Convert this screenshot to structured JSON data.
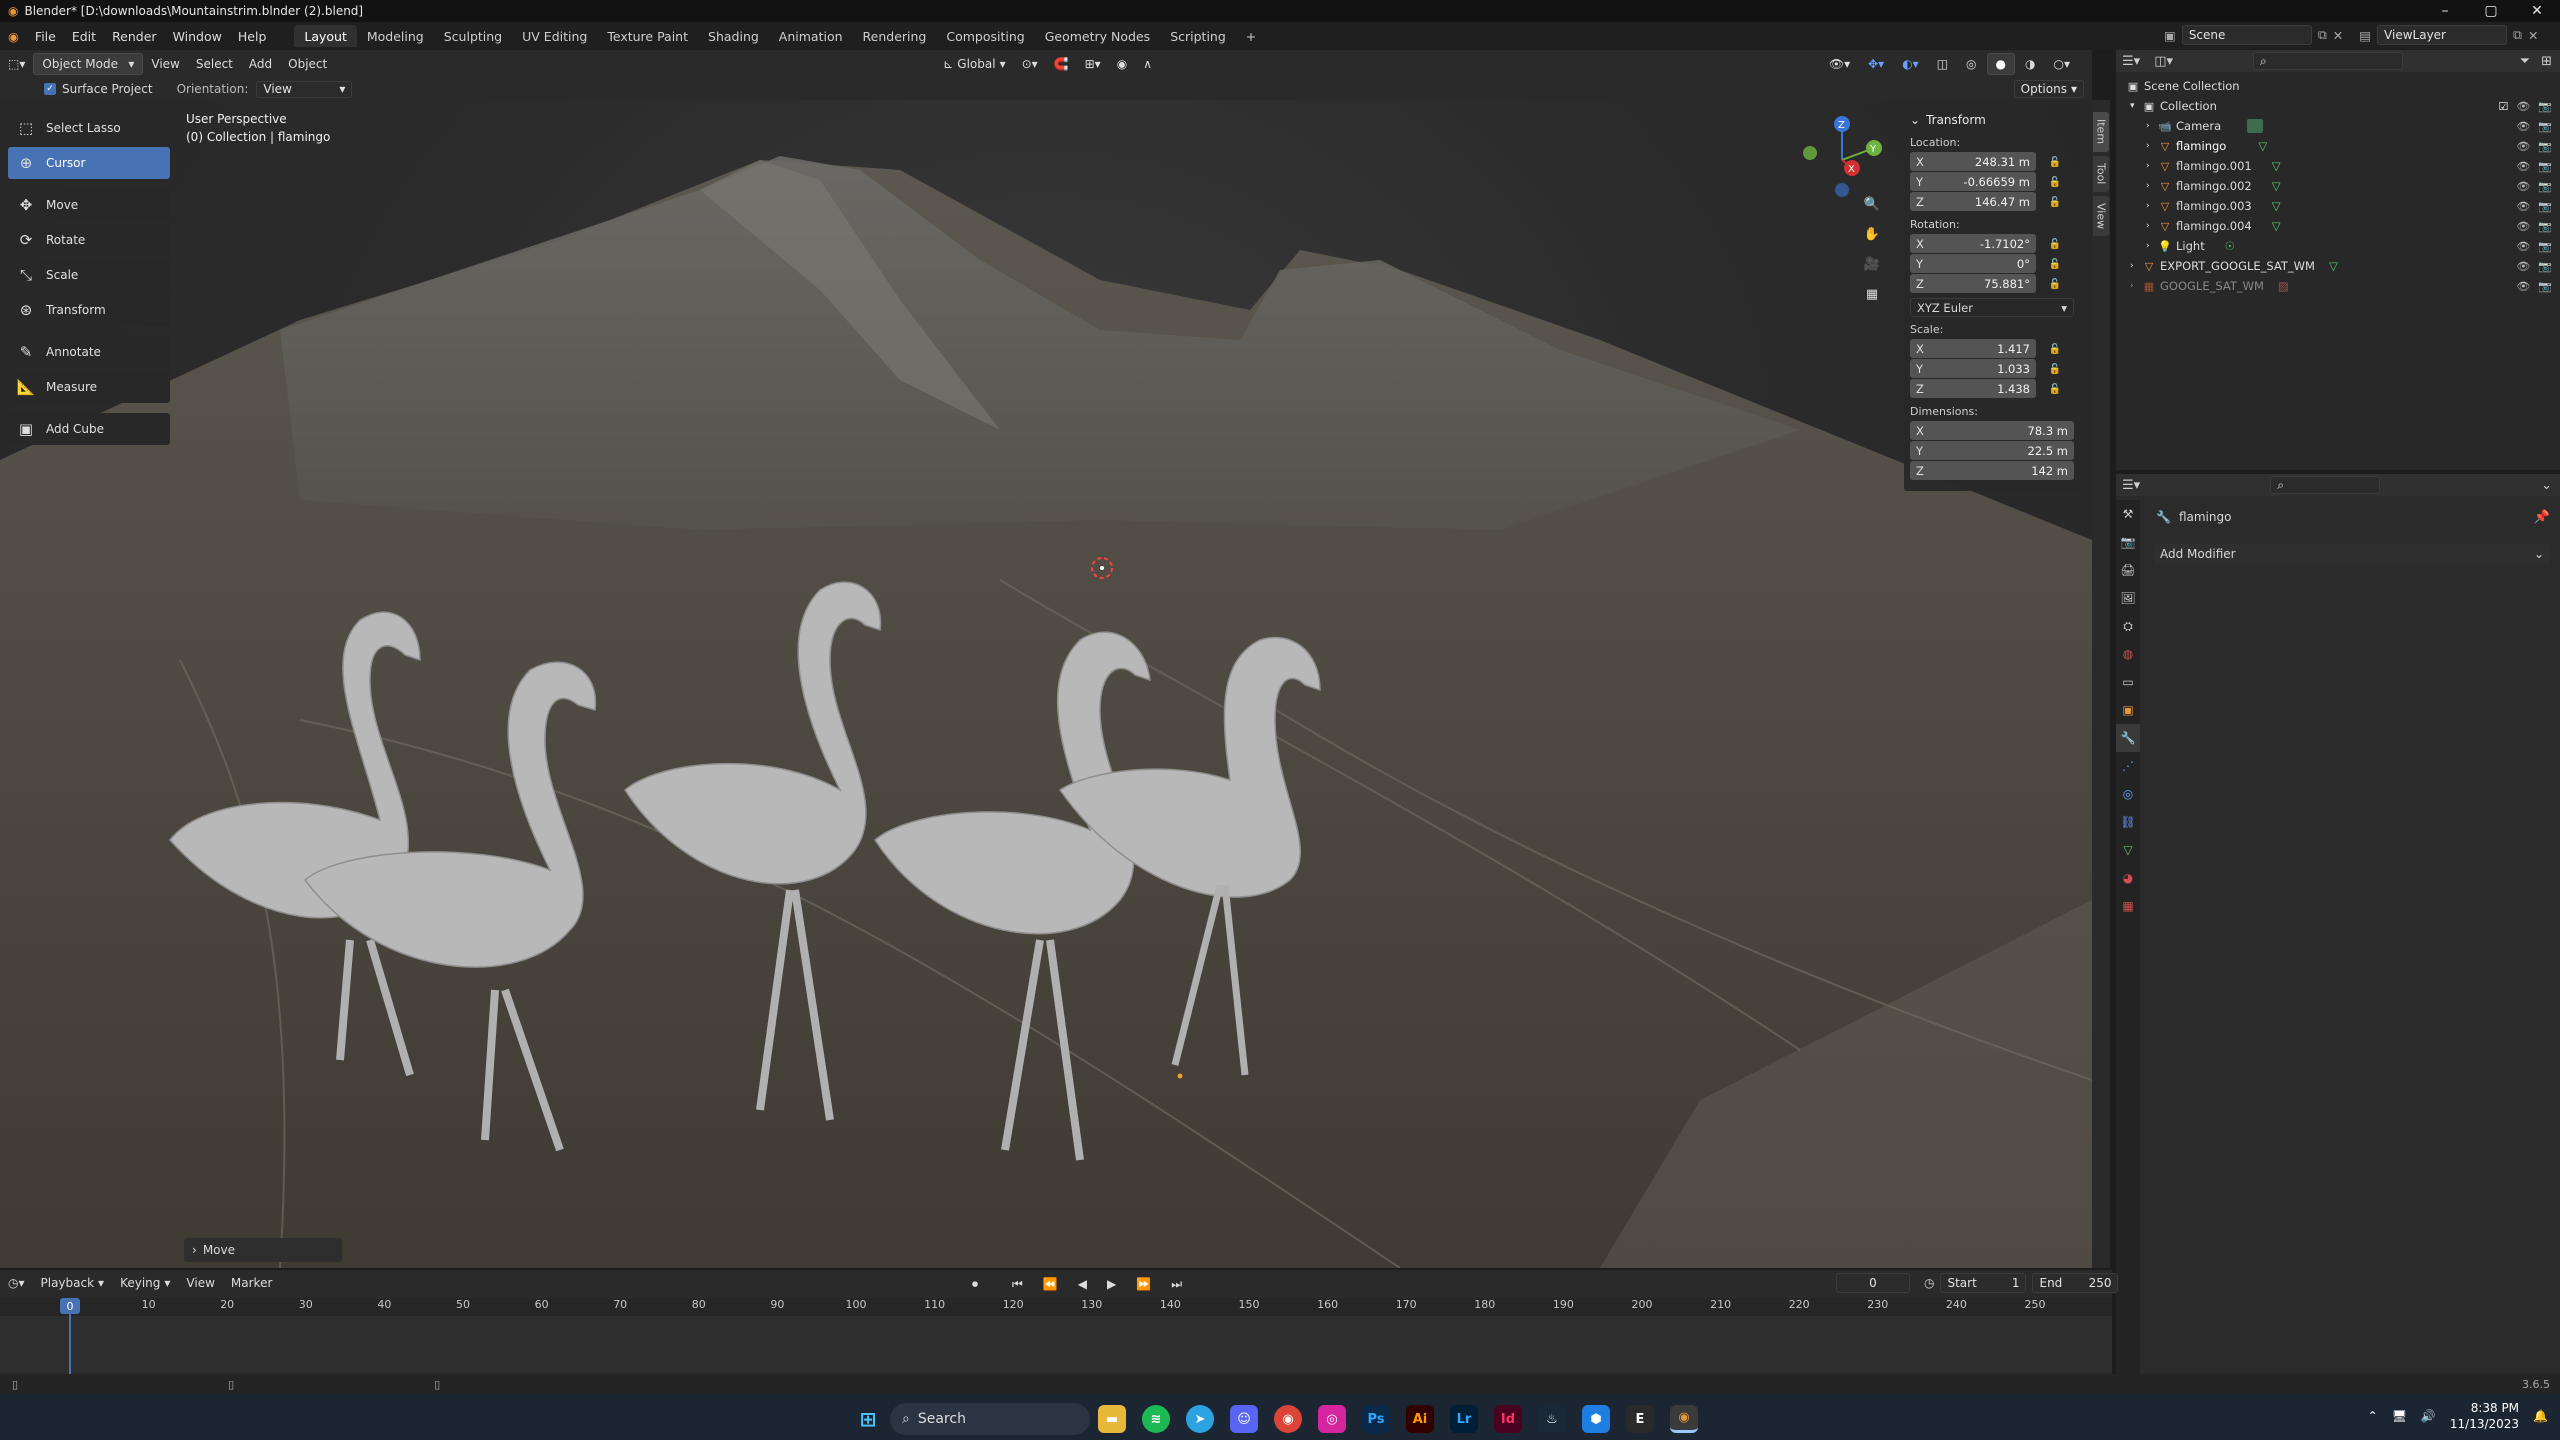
{
  "window": {
    "title": "Blender* [D:\\downloads\\Mountainstrim.blnder (2).blend]",
    "controls": [
      "–",
      "▢",
      "✕"
    ]
  },
  "menus": [
    "File",
    "Edit",
    "Render",
    "Window",
    "Help"
  ],
  "workspaces": [
    "Layout",
    "Modeling",
    "Sculpting",
    "UV Editing",
    "Texture Paint",
    "Shading",
    "Animation",
    "Rendering",
    "Compositing",
    "Geometry Nodes",
    "Scripting"
  ],
  "workspace_add": "+",
  "scene": {
    "label": "Scene",
    "viewlayer": "ViewLayer"
  },
  "viewport_header": {
    "mode": "Object Mode",
    "menus": [
      "View",
      "Select",
      "Add",
      "Object"
    ],
    "orientation": "Global"
  },
  "tool_options": {
    "surface_project": "Surface Project",
    "orientation_label": "Orientation:",
    "orientation_value": "View",
    "options": "Options"
  },
  "viewport": {
    "perspective": "User Perspective",
    "collection_info": "(0) Collection | flamingo",
    "gizmo": {
      "z": "Z",
      "y": "Y",
      "x": "X"
    },
    "last_op": "Move"
  },
  "toolbar": [
    {
      "label": "Select Lasso",
      "icon": "lasso-icon",
      "active": false
    },
    {
      "label": "Cursor",
      "icon": "cursor-icon",
      "active": true
    },
    {
      "label": "Move",
      "icon": "move-icon",
      "active": false
    },
    {
      "label": "Rotate",
      "icon": "rotate-icon",
      "active": false
    },
    {
      "label": "Scale",
      "icon": "scale-icon",
      "active": false
    },
    {
      "label": "Transform",
      "icon": "transform-icon",
      "active": false
    },
    {
      "label": "Annotate",
      "icon": "annotate-icon",
      "active": false
    },
    {
      "label": "Measure",
      "icon": "measure-icon",
      "active": false
    },
    {
      "label": "Add Cube",
      "icon": "add-cube-icon",
      "active": false
    }
  ],
  "npanel": {
    "title": "Transform",
    "location_label": "Location:",
    "location": [
      [
        "X",
        "248.31 m"
      ],
      [
        "Y",
        "-0.66659 m"
      ],
      [
        "Z",
        "146.47 m"
      ]
    ],
    "rotation_label": "Rotation:",
    "rotation": [
      [
        "X",
        "-1.7102°"
      ],
      [
        "Y",
        "0°"
      ],
      [
        "Z",
        "75.881°"
      ]
    ],
    "rotation_mode": "XYZ Euler",
    "scale_label": "Scale:",
    "scale": [
      [
        "X",
        "1.417"
      ],
      [
        "Y",
        "1.033"
      ],
      [
        "Z",
        "1.438"
      ]
    ],
    "dimensions_label": "Dimensions:",
    "dimensions": [
      [
        "X",
        "78.3 m"
      ],
      [
        "Y",
        "22.5 m"
      ],
      [
        "Z",
        "142 m"
      ]
    ],
    "tabs": [
      "Item",
      "Tool",
      "View"
    ]
  },
  "outliner": {
    "root": "Scene Collection",
    "items": [
      {
        "name": "Collection",
        "indent": 1,
        "type": "collection"
      },
      {
        "name": "Camera",
        "indent": 2,
        "type": "camera"
      },
      {
        "name": "flamingo",
        "indent": 2,
        "type": "mesh"
      },
      {
        "name": "flamingo.001",
        "indent": 2,
        "type": "mesh"
      },
      {
        "name": "flamingo.002",
        "indent": 2,
        "type": "mesh"
      },
      {
        "name": "flamingo.003",
        "indent": 2,
        "type": "mesh"
      },
      {
        "name": "flamingo.004",
        "indent": 2,
        "type": "mesh"
      },
      {
        "name": "Light",
        "indent": 2,
        "type": "light"
      },
      {
        "name": "EXPORT_GOOGLE_SAT_WM",
        "indent": 1,
        "type": "mesh"
      },
      {
        "name": "GOOGLE_SAT_WM",
        "indent": 1,
        "type": "image"
      }
    ]
  },
  "properties": {
    "object": "flamingo",
    "add_modifier": "Add Modifier"
  },
  "timeline": {
    "menus": [
      "Playback",
      "Keying",
      "View",
      "Marker"
    ],
    "current_frame": "0",
    "start_label": "Start",
    "start": "1",
    "end_label": "End",
    "end": "250",
    "ticks": [
      "0",
      "10",
      "20",
      "30",
      "40",
      "50",
      "60",
      "70",
      "80",
      "90",
      "100",
      "110",
      "120",
      "130",
      "140",
      "150",
      "160",
      "170",
      "180",
      "190",
      "200",
      "210",
      "220",
      "230",
      "240",
      "250"
    ]
  },
  "status": {
    "version": "3.6.5"
  },
  "taskbar": {
    "search": "Search",
    "time": "8:38 PM",
    "date": "11/13/2023"
  },
  "colors": {
    "accent": "#4772b3",
    "orange": "#e8973a",
    "green": "#5fc56f"
  }
}
